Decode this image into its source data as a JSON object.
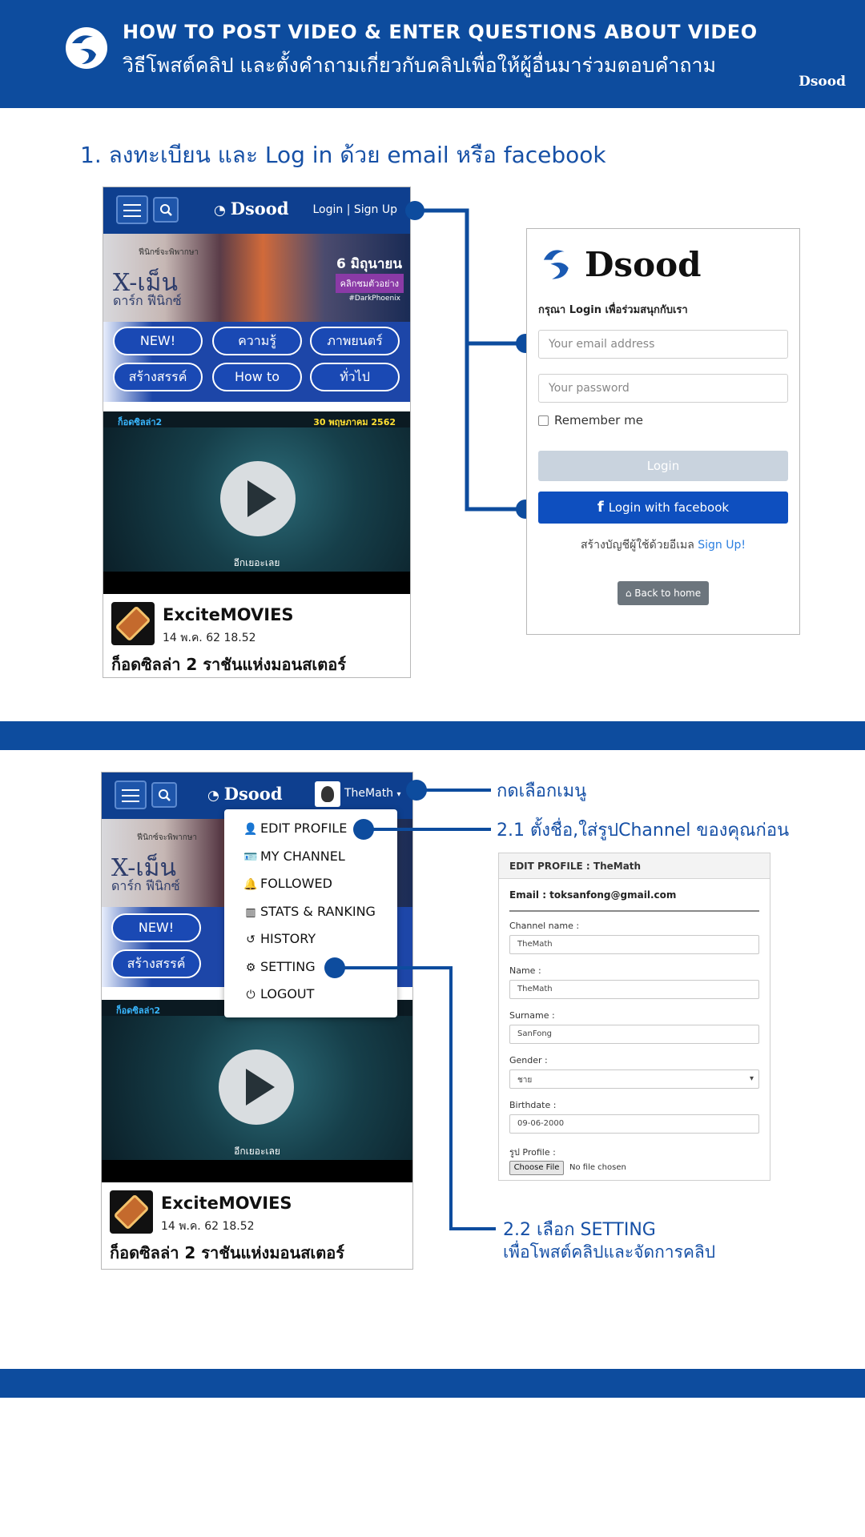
{
  "colors": {
    "brand_blue": "#0d4c9e",
    "dot_blue": "#0d4c9e",
    "facebook_blue": "#0e4fbf",
    "link_blue": "#2b7fe0"
  },
  "header": {
    "title": "HOW TO POST VIDEO & ENTER QUESTIONS ABOUT VIDEO",
    "subtitle": "วิธีโพสต์คลิป และตั้งคำถามเกี่ยวกับคลิปเพื่อให้ผู้อื่นมาร่วมตอบคำถาม",
    "brand": "Dsood"
  },
  "step1": {
    "title": "1. ลงทะเบียน และ Log in ด้วย email หรือ facebook"
  },
  "phone": {
    "brand": "Dsood",
    "login_link": "Login | Sign Up",
    "banner_title": "X-เม็น",
    "banner_subtitle": "ดาร์ก ฟีนิกซ์",
    "banner_tagline": "ฟีนิกซ์จะพิพากษา",
    "banner_date": "6 มิถุนายน",
    "banner_cta": "คลิกชมตัวอย่าง",
    "banner_hashtag": "#DarkPhoenix",
    "categories": [
      "NEW!",
      "ความรู้",
      "ภาพยนตร์",
      "สร้างสรรค์",
      "How to",
      "ทั่วไป"
    ],
    "video_tag": "ก็อดซิลล่า2",
    "video_date": "30 พฤษภาคม 2562",
    "video_caption": "อีกเยอะเลย",
    "channel_name": "ExciteMOVIES",
    "channel_date": "14 พ.ค. 62    18.52",
    "video_title": "ก็อดซิลล่า 2 ราชันแห่งมอนสเตอร์",
    "user_name": "TheMath"
  },
  "login_form": {
    "brand": "Dsood",
    "prompt": "กรุณา Login เพื่อร่วมสนุกกับเรา",
    "email_placeholder": "Your email address",
    "password_placeholder": "Your password",
    "remember_label": "Remember me",
    "login_button": "Login",
    "facebook_button": "Login with facebook",
    "signup_text": "สร้างบัญชีผู้ใช้ด้วยอีเมล",
    "signup_link": "Sign Up!",
    "back_button": "Back to home"
  },
  "dropdown": {
    "items": [
      {
        "label": "EDIT PROFILE",
        "icon": "user-icon"
      },
      {
        "label": "MY CHANNEL",
        "icon": "id-card-icon"
      },
      {
        "label": "FOLLOWED",
        "icon": "bell-icon"
      },
      {
        "label": "STATS & RANKING",
        "icon": "bar-chart-icon"
      },
      {
        "label": "HISTORY",
        "icon": "history-icon"
      },
      {
        "label": "SETTING",
        "icon": "gear-icon"
      },
      {
        "label": "LOGOUT",
        "icon": "power-icon"
      }
    ]
  },
  "callouts": {
    "select_menu": "กดเลือกเมนู",
    "step_2_1": "2.1 ตั้งชื่อ,ใส่รูปChannel ของคุณก่อน",
    "step_2_2_line1": "2.2 เลือก SETTING",
    "step_2_2_line2": "เพื่อโพสต์คลิปและจัดการคลิป"
  },
  "edit_profile": {
    "header": "EDIT PROFILE : TheMath",
    "email_line": "Email : toksanfong@gmail.com",
    "channel_label": "Channel name :",
    "channel_value": "TheMath",
    "name_label": "Name :",
    "name_value": "TheMath",
    "surname_label": "Surname :",
    "surname_value": "SanFong",
    "gender_label": "Gender :",
    "gender_value": "ชาย",
    "birthdate_label": "Birthdate :",
    "birthdate_value": "09-06-2000",
    "profile_label": "รูป Profile :",
    "choose_file": "Choose File",
    "no_file": "No file chosen"
  }
}
